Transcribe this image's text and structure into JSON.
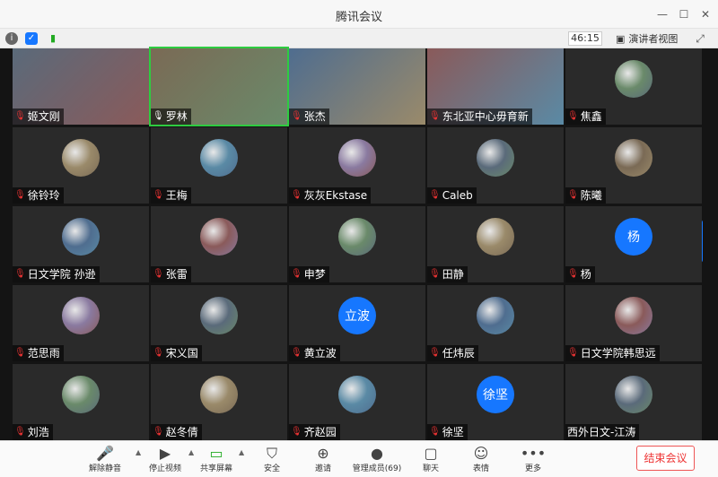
{
  "window": {
    "title": "腾讯会议"
  },
  "status": {
    "timer": "46:15",
    "speaker_view": "演讲者视图"
  },
  "participants": [
    {
      "name": "姬文刚"
    },
    {
      "name": "罗林"
    },
    {
      "name": "张杰"
    },
    {
      "name": "东北亚中心毋育新"
    },
    {
      "name": "焦鑫"
    },
    {
      "name": "徐铃玲"
    },
    {
      "name": "王梅"
    },
    {
      "name": "灰灰Ekstase"
    },
    {
      "name": "Caleb"
    },
    {
      "name": "陈曦"
    },
    {
      "name": "日文学院 孙逊"
    },
    {
      "name": "张雷"
    },
    {
      "name": "申梦"
    },
    {
      "name": "田静"
    },
    {
      "name": "杨",
      "avatar_text": "杨"
    },
    {
      "name": "范思雨"
    },
    {
      "name": "宋义国"
    },
    {
      "name": "黄立波",
      "avatar_text": "立波"
    },
    {
      "name": "任炜辰"
    },
    {
      "name": "日文学院韩思远"
    },
    {
      "name": "刘浩"
    },
    {
      "name": "赵冬倩"
    },
    {
      "name": "齐赵园"
    },
    {
      "name": "徐坚",
      "avatar_text": "徐坚"
    },
    {
      "name": "西外日文-江涛"
    }
  ],
  "toolbar": {
    "mute": "解除静音",
    "video": "停止视频",
    "share": "共享屏幕",
    "security": "安全",
    "invite": "邀请",
    "members": "管理成员(69)",
    "chat": "聊天",
    "reactions": "表情",
    "more": "更多",
    "end": "结束会议"
  },
  "colors": {
    "accent": "#1677ff",
    "end_red": "#e33333",
    "tile_bg": "#2a2a2a",
    "grid_bg": "#141414"
  }
}
